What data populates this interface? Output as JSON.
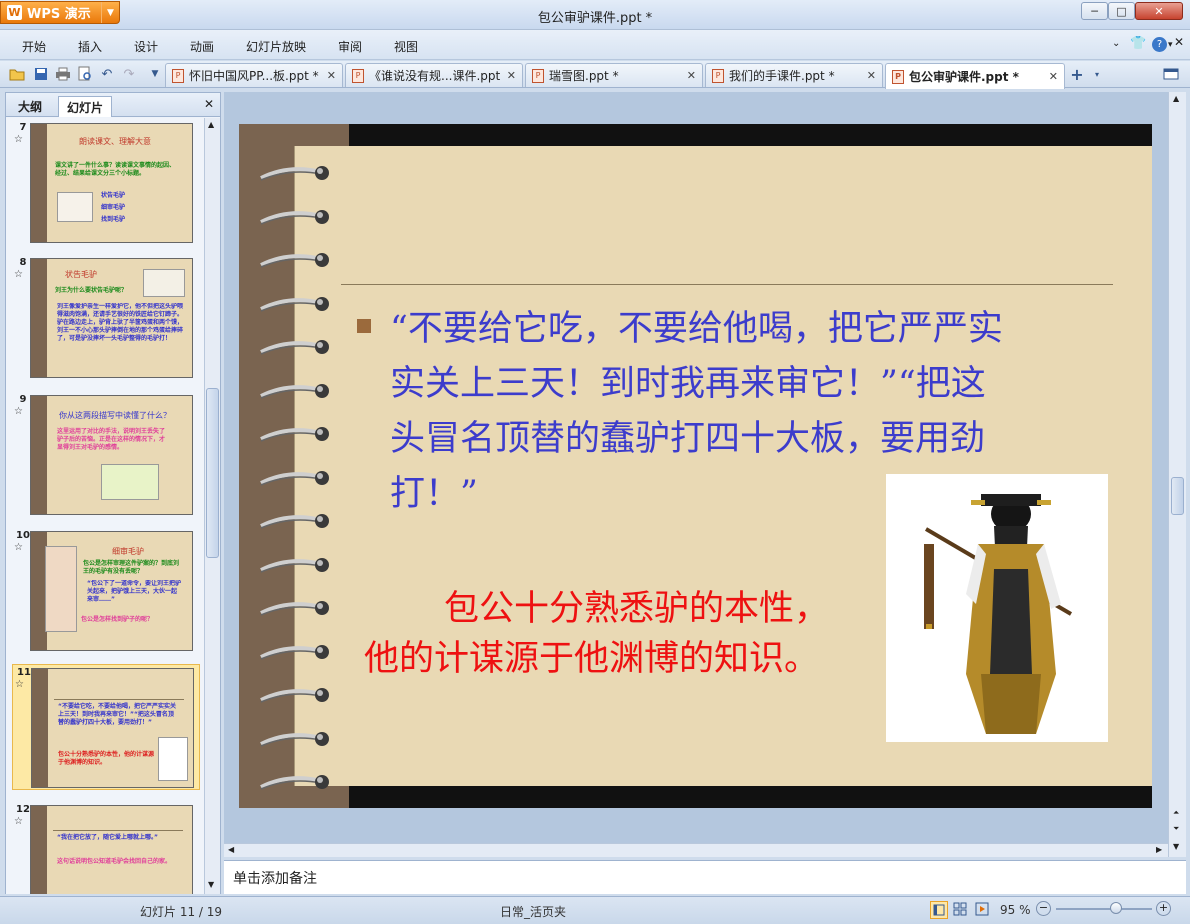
{
  "window": {
    "title": "包公审驴课件.ppt *",
    "app_button": "WPS 演示",
    "controls": {
      "minimize": "─",
      "maximize": "□",
      "close": "✕"
    }
  },
  "menu": {
    "items": [
      "开始",
      "插入",
      "设计",
      "动画",
      "幻灯片放映",
      "审阅",
      "视图"
    ]
  },
  "tabs": [
    {
      "label": "怀旧中国风PP...板.ppt *"
    },
    {
      "label": "《谁说没有规...课件.ppt"
    },
    {
      "label": "瑞雪图.ppt *"
    },
    {
      "label": "我们的手课件.ppt *"
    },
    {
      "label": "包公审驴课件.ppt *"
    }
  ],
  "left_panel": {
    "tab_outline": "大纲",
    "tab_slides": "幻灯片"
  },
  "thumbnails": [
    {
      "num": "7",
      "star": "☆",
      "title": "朗读课文、理解大意",
      "body": "课文讲了一件什么事？读读课文事情的起因、经过、结果给课文分三个小标题。",
      "items": [
        "状告毛驴",
        "细审毛驴",
        "找到毛驴"
      ]
    },
    {
      "num": "8",
      "star": "☆",
      "title": "状告毛驴",
      "q": "刘王为什么要状告毛驴呢？",
      "body": "刘王像爱护亲生一样爱护它，他不但把这头驴喂得滋肉饱满，还请手艺很好的铁匠给它钉蹄子。驴在路边走上，驴背上驮了半筐鸡蛋和两个馍，刘王一不小心那头驴摔倒在地的那个鸡蛋给摔碎了，可是驴没摔坏一头毛驴整得的毛驴打！"
    },
    {
      "num": "9",
      "star": "☆",
      "title": "你从这两段描写中读懂了什么？",
      "body": "这里运用了对比的手法，说明刘王丢失了驴子后的苦恼。正是在这样的情况下，才显得刘王对毛驴的感情。"
    },
    {
      "num": "10",
      "star": "☆",
      "title": "细审毛驴",
      "q": "包公是怎样审理这件驴案的？到底刘王的毛驴有没有丢呢？",
      "body": "“包公下了一道命令，要让刘王把驴关起来，把驴饿上三天，大伙一起来审……”",
      "body2": "包公是怎样找到驴子的呢？"
    },
    {
      "num": "11",
      "star": "☆",
      "body": "“不要给它吃，不要给他喝，把它严严实实关上三天！到时我再来审它！”“把这头冒名顶替的蠢驴打四十大板，要用劲打！”",
      "body2": "包公十分熟悉驴的本性，他的计谋源于他渊博的知识。"
    },
    {
      "num": "12",
      "star": "☆",
      "body": "“我在把它放了，随它爱上哪就上哪。”",
      "body2": "这句话说明包公知道毛驴会找回自己的家。"
    }
  ],
  "slide": {
    "quote": "“不要给它吃，不要给他喝，把它严严实实关上三天！到时我再来审它！”“把这头冒名顶替的蠢驴打四十大板，要用劲打！”",
    "red_line1": "包公十分熟悉驴的本性，",
    "red_line2": "他的计谋源于他渊博的知识。"
  },
  "notes": {
    "placeholder": "单击添加备注"
  },
  "status": {
    "slide_counter": "幻灯片 11 / 19",
    "template": "日常_活页夹",
    "zoom": "95 %",
    "zoom_fraction": 0.62
  },
  "colors": {
    "accent_orange": "#e9780a",
    "slide_blue": "#3c3ccc",
    "slide_red": "#ee1111",
    "paper": "#e9d9b4",
    "spine": "#7a6450"
  }
}
